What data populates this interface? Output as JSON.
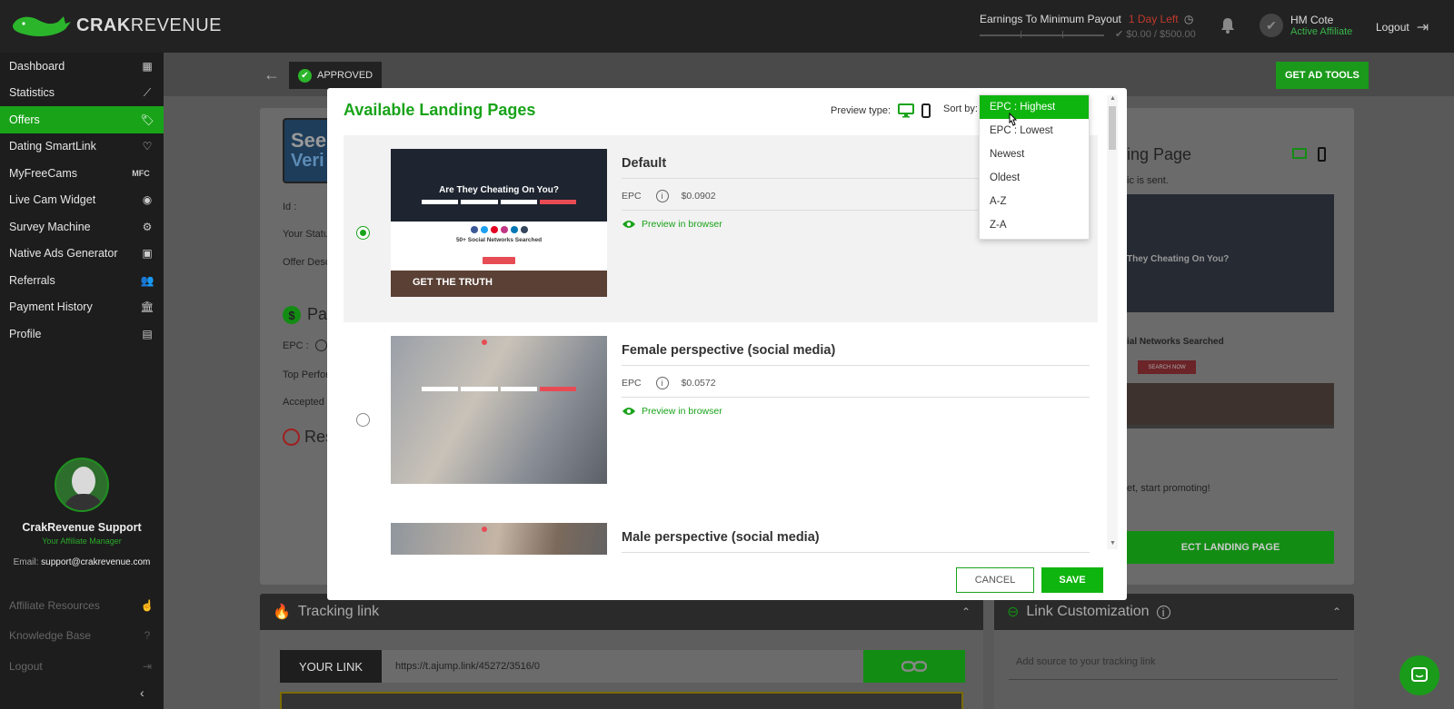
{
  "topbar": {
    "logo_bold": "CRAK",
    "logo_light": "REVENUE",
    "earnings_label": "Earnings To Minimum Payout",
    "days_left": "1 Day Left",
    "earnings_amount": "$0.00 / $500.00",
    "user_name": "HM Cote",
    "user_status": "Active Affiliate",
    "logout": "Logout"
  },
  "sidebar": {
    "items": [
      {
        "label": "Dashboard",
        "icon": "dashboard-icon"
      },
      {
        "label": "Statistics",
        "icon": "chart-line-icon"
      },
      {
        "label": "Offers",
        "icon": "tag-icon"
      },
      {
        "label": "Dating SmartLink",
        "icon": "heart-link-icon"
      },
      {
        "label": "MyFreeCams",
        "icon": "mfc-icon",
        "icon_text": "MFC"
      },
      {
        "label": "Live Cam Widget",
        "icon": "webcam-icon"
      },
      {
        "label": "Survey Machine",
        "icon": "survey-icon"
      },
      {
        "label": "Native Ads Generator",
        "icon": "native-ads-icon"
      },
      {
        "label": "Referrals",
        "icon": "add-user-icon"
      },
      {
        "label": "Payment History",
        "icon": "bank-icon"
      },
      {
        "label": "Profile",
        "icon": "profile-card-icon"
      }
    ],
    "active_index": 2,
    "support_name": "CrakRevenue Support",
    "support_role": "Your Affiliate Manager",
    "support_email_label": "Email:",
    "support_email": "support@crakrevenue.com",
    "bottom_items": [
      {
        "label": "Affiliate Resources",
        "icon": "resources-icon"
      },
      {
        "label": "Knowledge Base",
        "icon": "help-icon"
      },
      {
        "label": "Logout",
        "icon": "logout-icon"
      }
    ]
  },
  "content": {
    "approved": "APPROVED",
    "get_ad_tools": "GET AD TOOLS",
    "left_labels": [
      "Id :",
      "Your Status",
      "Offer Desc",
      "EPC :",
      "Top Perfor",
      "Accepted"
    ],
    "payout_partial": "Pa",
    "restrict_partial": "Res",
    "right_title_partial": "ing Page",
    "right_sub_partial": "ic is sent.",
    "right_promo_partial": "et, start promoting!",
    "right_select_partial": "ECT LANDING PAGE",
    "right_thumb_title_partial": "They Cheating On You?",
    "right_thumb_sub_partial": "ial Networks Searched",
    "right_thumb_button": "SEARCH NOW",
    "seen_partial_1": "See",
    "seen_partial_2": "Veri",
    "tracking_title": "Tracking link",
    "your_link": "YOUR LINK",
    "link_url": "https://t.ajump.link/45272/3516/0",
    "link_customization": "Link Customization",
    "add_source_placeholder": "Add source to your tracking link"
  },
  "modal": {
    "title": "Available Landing Pages",
    "preview_type": "Preview type:",
    "sort_by": "Sort by:",
    "epc_label": "EPC",
    "preview_link": "Preview in browser",
    "landing_pages": [
      {
        "name": "Default",
        "epc": "$0.0902",
        "selected": true,
        "thumb_title": "Are They Cheating On You?",
        "thumb_sub": "50+ Social Networks Searched",
        "thumb_banner": "GET THE TRUTH"
      },
      {
        "name": "Female perspective (social media)",
        "epc": "$0.0572",
        "selected": false
      },
      {
        "name": "Male perspective (social media)",
        "epc": "",
        "selected": false
      }
    ],
    "cancel": "CANCEL",
    "save": "SAVE"
  },
  "sort_dropdown": {
    "options": [
      "EPC : Highest",
      "EPC : Lowest",
      "Newest",
      "Oldest",
      "A-Z",
      "Z-A"
    ],
    "highlighted_index": 0
  },
  "colors": {
    "brand_green": "#19a319",
    "save_green": "#0fb50f",
    "topbar": "#222222",
    "sidebar": "#1d1d1d"
  }
}
